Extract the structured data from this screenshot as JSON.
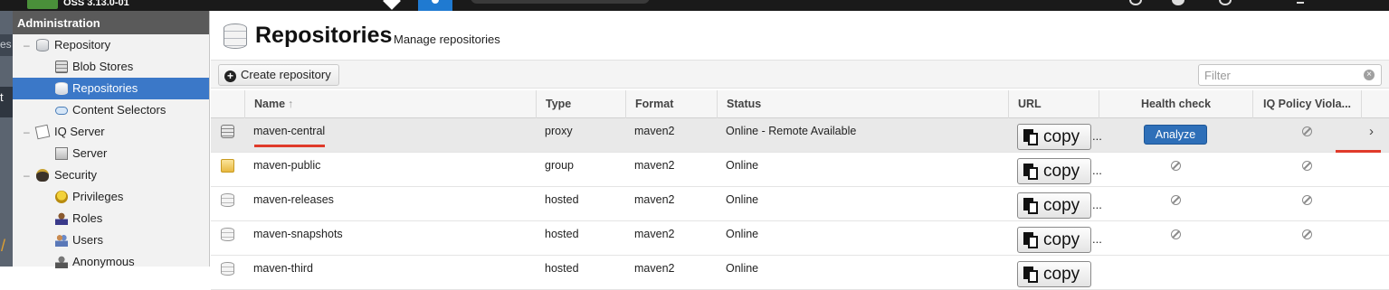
{
  "topbar": {
    "version": "OSS 3.13.0-01"
  },
  "left_edge": {
    "text_1": "es",
    "text_2": "t",
    "text_3": "/"
  },
  "sidebar": {
    "header": "Administration",
    "items": [
      {
        "label": "Repository",
        "icon": "database-icon",
        "toggle": "–"
      },
      {
        "label": "Blob Stores",
        "icon": "blob-store-icon"
      },
      {
        "label": "Repositories",
        "icon": "database-icon",
        "selected": true
      },
      {
        "label": "Content Selectors",
        "icon": "content-selector-icon"
      },
      {
        "label": "IQ Server",
        "icon": "iq-server-icon",
        "toggle": "–"
      },
      {
        "label": "Server",
        "icon": "server-icon"
      },
      {
        "label": "Security",
        "icon": "security-icon",
        "toggle": "–"
      },
      {
        "label": "Privileges",
        "icon": "medal-icon"
      },
      {
        "label": "Roles",
        "icon": "role-icon"
      },
      {
        "label": "Users",
        "icon": "users-icon"
      },
      {
        "label": "Anonymous",
        "icon": "anonymous-icon"
      }
    ]
  },
  "page": {
    "title": "Repositories",
    "subtitle": "Manage repositories"
  },
  "toolbar": {
    "create_label": "Create repository",
    "filter_placeholder": "Filter",
    "filter_clear": "×"
  },
  "grid": {
    "columns": {
      "name": "Name",
      "sort": "↑",
      "type": "Type",
      "format": "Format",
      "status": "Status",
      "url": "URL",
      "health": "Health check",
      "iq": "IQ Policy Viola..."
    },
    "copy_label": "copy",
    "url_ellipsis": "...",
    "analyze_label": "Analyze",
    "chevron": "›",
    "rows": [
      {
        "name": "maven-central",
        "type": "proxy",
        "format": "maven2",
        "status": "Online - Remote Available",
        "icon": "proxy-repo-icon"
      },
      {
        "name": "maven-public",
        "type": "group",
        "format": "maven2",
        "status": "Online",
        "icon": "group-repo-icon"
      },
      {
        "name": "maven-releases",
        "type": "hosted",
        "format": "maven2",
        "status": "Online",
        "icon": "hosted-repo-icon"
      },
      {
        "name": "maven-snapshots",
        "type": "hosted",
        "format": "maven2",
        "status": "Online",
        "icon": "hosted-repo-icon"
      },
      {
        "name": "maven-third",
        "type": "hosted",
        "format": "maven2",
        "status": "Online",
        "icon": "hosted-repo-icon"
      }
    ]
  },
  "colors": {
    "selection": "#3b78c8",
    "analyze_button": "#2e6fb8",
    "annotation": "#e03a2a",
    "sidebar_header": "#5a5a5a"
  }
}
